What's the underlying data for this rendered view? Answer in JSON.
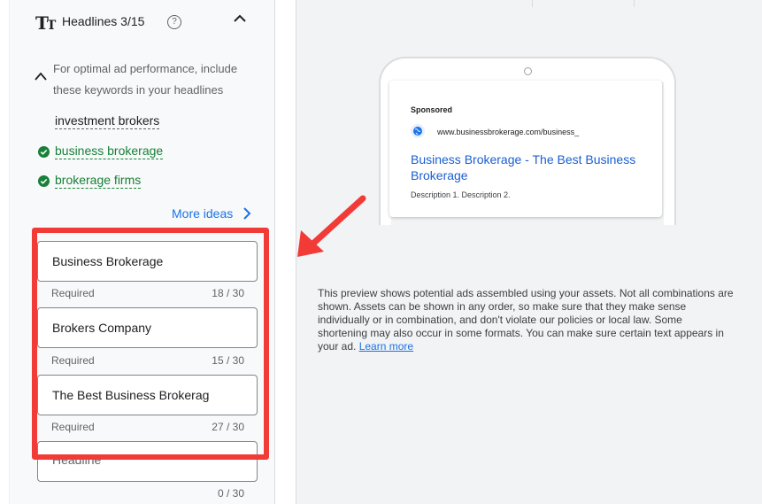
{
  "headlines": {
    "title": "Headlines 3/15",
    "hint": "For optimal ad performance, include these keywords in your headlines",
    "keywords": [
      {
        "text": "investment brokers",
        "used": false
      },
      {
        "text": "business brokerage",
        "used": true
      },
      {
        "text": "brokerage firms",
        "used": true
      }
    ],
    "more_ideas": "More ideas",
    "fields": [
      {
        "value": "Business Brokerage",
        "helper": "Required",
        "count": "18 / 30"
      },
      {
        "value": "Brokers Company",
        "helper": "Required",
        "count": "15 / 30"
      },
      {
        "value": "The Best Business Brokerag",
        "helper": "Required",
        "count": "27 / 30"
      },
      {
        "placeholder": "Headline",
        "helper": "",
        "count": "0 / 30"
      }
    ]
  },
  "preview": {
    "sponsored": "Sponsored",
    "url": "www.businessbrokerage.com/business_",
    "headline": "Business Brokerage - The Best Business Brokerage",
    "description": "Description 1. Description 2.",
    "note": "This preview shows potential ads assembled using your assets. Not all combinations are shown. Assets can be shown in any order, so make sure that they make sense individually or in combination, and don't violate our policies or local law. Some shortening may also occur in some formats. You can make sure certain text appears in your ad.",
    "learn_more": "Learn more"
  },
  "colors": {
    "accent": "#1a73e8",
    "success": "#188038",
    "annotation": "#f23a36"
  },
  "icons": {
    "title": "text-format-icon",
    "help": "help-circle-icon",
    "collapse": "chevron-up-icon",
    "check": "check-circle-icon",
    "more": "chevron-right-icon",
    "globe": "globe-icon",
    "annotation": "red-arrow-icon"
  }
}
